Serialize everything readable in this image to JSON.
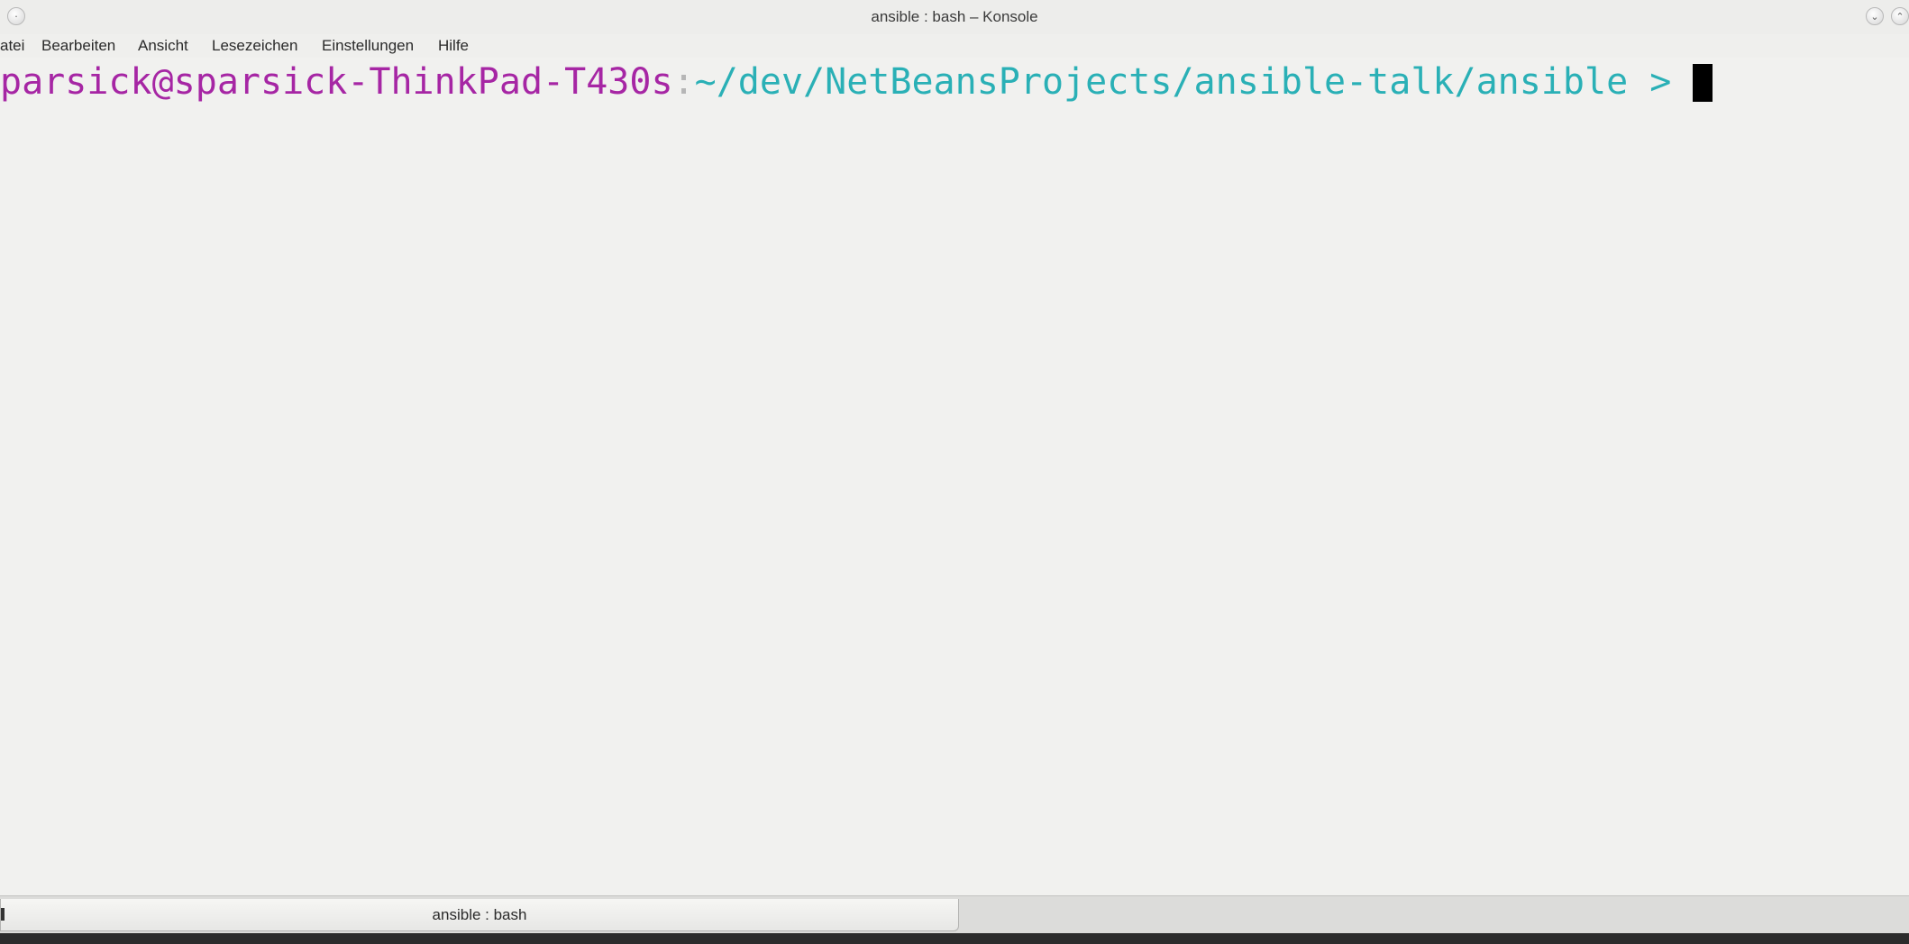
{
  "window": {
    "title": "ansible : bash – Konsole"
  },
  "menubar": {
    "items": [
      "atei",
      "Bearbeiten",
      "Ansicht",
      "Lesezeichen",
      "Einstellungen",
      "Hilfe"
    ]
  },
  "terminal": {
    "user_host": "parsick@sparsick-ThinkPad-T430s",
    "separator": ":",
    "path_prompt": "~/dev/NetBeansProjects/ansible-talk/ansible > ",
    "colors": {
      "user_host": "#a626a4",
      "path": "#2ab0b6",
      "background": "#f1f1ef",
      "cursor": "#000000"
    }
  },
  "tabs": [
    {
      "label": "ansible : bash",
      "active": true
    }
  ],
  "icons": {
    "window_menu": "window-menu-icon",
    "minimize": "minimize-icon",
    "maximize": "maximize-icon",
    "tab": "terminal-tab-icon"
  }
}
